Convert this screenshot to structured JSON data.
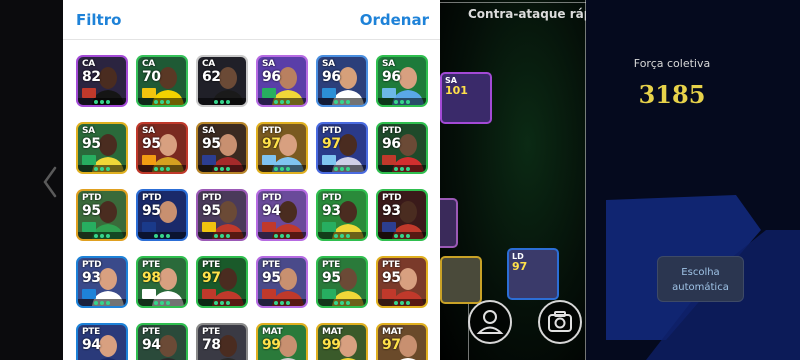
{
  "header": {
    "filter_label": "Filtro",
    "order_label": "Ordenar"
  },
  "formation": {
    "title": "Contra-ataque rápido"
  },
  "team": {
    "strength_label": "Força coletiva",
    "strength_value": "3185",
    "auto_select_line1": "Escolha",
    "auto_select_line2": "automática"
  },
  "colors": {
    "accent_blue": "#1e82d8",
    "strength_gold": "#e7d24a",
    "selection_green": "#36d48b"
  },
  "cards": [
    {
      "pos": "CA",
      "rating": "82",
      "frame": "#a34ad6",
      "bg": "#2b2440",
      "badge": "#c0392b",
      "skin": "#4a2c20",
      "jersey": "#151515"
    },
    {
      "pos": "CA",
      "rating": "70",
      "frame": "#36c25a",
      "bg": "#1f5a35",
      "badge": "#f1c40f",
      "skin": "#5a3825",
      "jersey": "#f2d200"
    },
    {
      "pos": "CA",
      "rating": "62",
      "frame": "#c9c9c9",
      "bg": "#202028",
      "badge": "",
      "skin": "#6b4a36",
      "jersey": "#1a1a1a"
    },
    {
      "pos": "SA",
      "rating": "96",
      "frame": "#b66be2",
      "bg": "#5a3ea8",
      "badge": "#27ae60",
      "skin": "#b98060",
      "jersey": "#f0d838"
    },
    {
      "pos": "SA",
      "rating": "96",
      "frame": "#4a8fe0",
      "bg": "#2c3f7a",
      "badge": "#2c8fd6",
      "skin": "#d6a07a",
      "jersey": "#ffffff"
    },
    {
      "pos": "SA",
      "rating": "96",
      "frame": "#2fbf4f",
      "bg": "#1e7a3a",
      "badge": "#6cb8e8",
      "skin": "#d8a080",
      "jersey": "#5aa8e8"
    },
    {
      "pos": "SA",
      "rating": "95",
      "frame": "#e0b020",
      "bg": "#2a6a3a",
      "badge": "#27ae60",
      "skin": "#4a2c20",
      "jersey": "#f0d838"
    },
    {
      "pos": "SA",
      "rating": "95",
      "frame": "#c0392b",
      "bg": "#7a2a20",
      "badge": "#f39c12",
      "skin": "#d8a080",
      "jersey": "#d4a020"
    },
    {
      "pos": "SA",
      "rating": "95",
      "frame": "#b8862a",
      "bg": "#3a2a20",
      "badge": "#2c3e90",
      "skin": "#c89070",
      "jersey": "#a52a2a"
    },
    {
      "pos": "PTD",
      "rating": "97",
      "frame": "#e0b020",
      "bg": "#7a5a20",
      "badge": "#7fc4f0",
      "skin": "#d8a080",
      "jersey": "#7fc4f0"
    },
    {
      "pos": "PTD",
      "rating": "97",
      "frame": "#4a6be0",
      "bg": "#2a3a8a",
      "badge": "#7fc4f0",
      "skin": "#4a2c20",
      "jersey": "#d0d0e8"
    },
    {
      "pos": "PTD",
      "rating": "96",
      "frame": "#2fbf4f",
      "bg": "#1e4a2a",
      "badge": "#c0392b",
      "skin": "#6b4a36",
      "jersey": "#d32f2f"
    },
    {
      "pos": "PTD",
      "rating": "95",
      "frame": "#e0a020",
      "bg": "#3a6a3a",
      "badge": "#27ae60",
      "skin": "#4a2c20",
      "jersey": "#2fa050"
    },
    {
      "pos": "PTD",
      "rating": "95",
      "frame": "#2c6ed6",
      "bg": "#1a2a6a",
      "badge": "#1a3a8a",
      "skin": "#c89070",
      "jersey": "#1a2a6a"
    },
    {
      "pos": "PTD",
      "rating": "95",
      "frame": "#9b59b6",
      "bg": "#4a3a5a",
      "badge": "#f1c40f",
      "skin": "#6b4a36",
      "jersey": "#c0392b"
    },
    {
      "pos": "PTD",
      "rating": "94",
      "frame": "#b66be2",
      "bg": "#6a4a9a",
      "badge": "#c0392b",
      "skin": "#4a2c20",
      "jersey": "#c0392b"
    },
    {
      "pos": "PTD",
      "rating": "93",
      "frame": "#2fbf4f",
      "bg": "#2a8a3a",
      "badge": "#27ae60",
      "skin": "#4a2c20",
      "jersey": "#f0d838"
    },
    {
      "pos": "PTD",
      "rating": "93",
      "frame": "#2fbf4f",
      "bg": "#3a1a1a",
      "badge": "#2c3e90",
      "skin": "#4a2c20",
      "jersey": "#c0392b"
    },
    {
      "pos": "PTD",
      "rating": "93",
      "frame": "#1e82d8",
      "bg": "#3a4a8a",
      "badge": "#1e82d8",
      "skin": "#d8a080",
      "jersey": "#ffffff"
    },
    {
      "pos": "PTE",
      "rating": "98",
      "frame": "#2fbf4f",
      "bg": "#2a6a3a",
      "badge": "#ffffff",
      "skin": "#d8a080",
      "jersey": "#ffffff"
    },
    {
      "pos": "PTE",
      "rating": "97",
      "frame": "#2fbf4f",
      "bg": "#1a5a2a",
      "badge": "#c0392b",
      "skin": "#4a2c20",
      "jersey": "#c0392b"
    },
    {
      "pos": "PTE",
      "rating": "95",
      "frame": "#b66be2",
      "bg": "#4a4a8a",
      "badge": "#c0392b",
      "skin": "#c89070",
      "jersey": "#c0392b"
    },
    {
      "pos": "PTE",
      "rating": "95",
      "frame": "#2fbf4f",
      "bg": "#2a7a3a",
      "badge": "#27ae60",
      "skin": "#6b4a36",
      "jersey": "#f0d838"
    },
    {
      "pos": "PTE",
      "rating": "95",
      "frame": "#e0b020",
      "bg": "#7a3a2a",
      "badge": "#c0392b",
      "skin": "#d8a080",
      "jersey": "#c0392b"
    },
    {
      "pos": "PTE",
      "rating": "94",
      "frame": "#1e82d8",
      "bg": "#2a3a7a",
      "badge": "",
      "skin": "#d8a080",
      "jersey": "#1a2a6a"
    },
    {
      "pos": "PTE",
      "rating": "94",
      "frame": "#2fbf4f",
      "bg": "#2a4a3a",
      "badge": "",
      "skin": "#6b4a36",
      "jersey": "#2a2a2a"
    },
    {
      "pos": "PTE",
      "rating": "78",
      "frame": "#8a8a8a",
      "bg": "#3a3a44",
      "badge": "",
      "skin": "#4a2c20",
      "jersey": "#2a2a2a"
    },
    {
      "pos": "MAT",
      "rating": "99",
      "frame": "#e0b020",
      "bg": "#2a7a3a",
      "badge": "",
      "skin": "#c89070",
      "jersey": "#d0d0d0"
    },
    {
      "pos": "MAT",
      "rating": "99",
      "frame": "#e0b020",
      "bg": "#3a5a2a",
      "badge": "",
      "skin": "#d8a080",
      "jersey": "#f0d838"
    },
    {
      "pos": "MAT",
      "rating": "97",
      "frame": "#e0b020",
      "bg": "#6a4a2a",
      "badge": "",
      "skin": "#c89070",
      "jersey": "#ffffff"
    }
  ],
  "pitch_cards": [
    {
      "pos": "SA",
      "rating": "101",
      "frame": "#a34ad6",
      "bg": "#3a2a6a"
    },
    {
      "pos": "LD",
      "rating": "97",
      "frame": "#2c6ed6",
      "bg": "#3a3a6a"
    }
  ]
}
